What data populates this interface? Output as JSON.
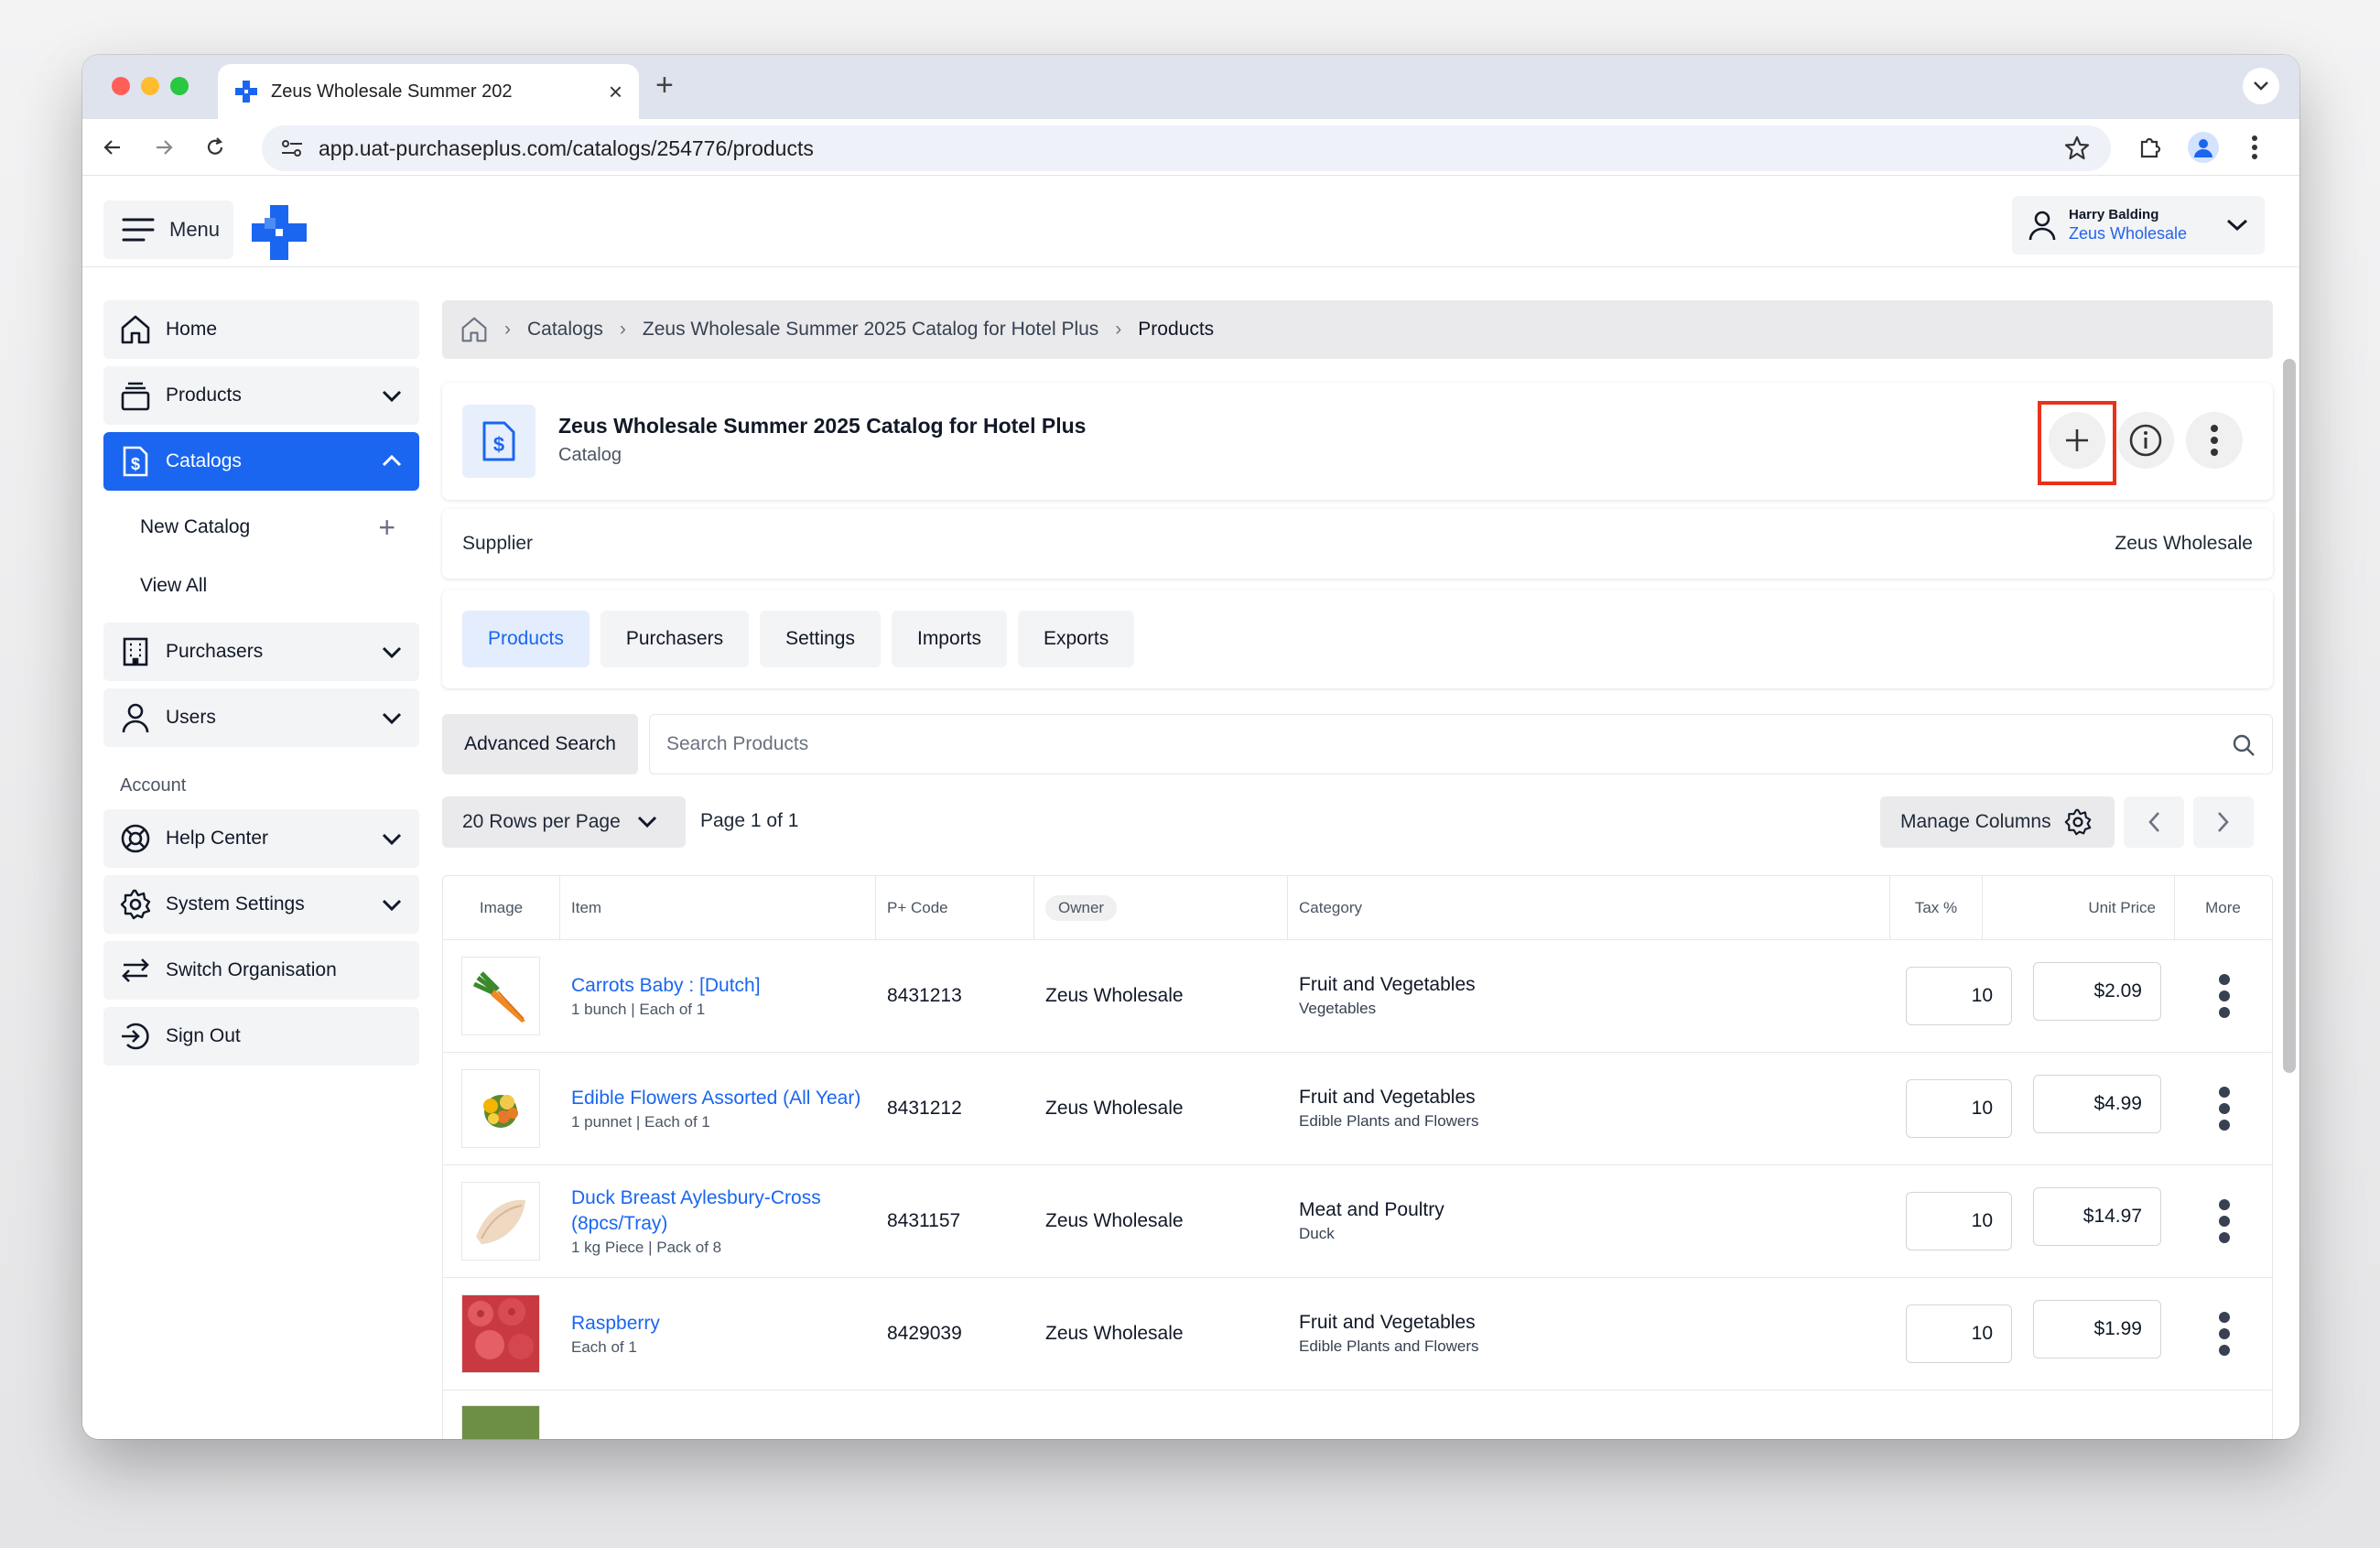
{
  "browser": {
    "tab_title": "Zeus Wholesale Summer 202",
    "url": "app.uat-purchaseplus.com/catalogs/254776/products",
    "new_tab": "+",
    "tab_close": "×"
  },
  "appbar": {
    "menu_label": "Menu",
    "user_name": "Harry Balding",
    "user_org": "Zeus Wholesale"
  },
  "sidebar": {
    "home": "Home",
    "products": "Products",
    "catalogs": "Catalogs",
    "new_catalog": "New Catalog",
    "view_all": "View All",
    "purchasers": "Purchasers",
    "users": "Users",
    "account_section": "Account",
    "help_center": "Help Center",
    "system_settings": "System Settings",
    "switch_org": "Switch Organisation",
    "sign_out": "Sign Out"
  },
  "breadcrumb": {
    "catalogs": "Catalogs",
    "catalog_name": "Zeus Wholesale Summer 2025 Catalog for Hotel Plus",
    "current": "Products"
  },
  "header": {
    "title": "Zeus Wholesale Summer 2025 Catalog for Hotel Plus",
    "subtitle": "Catalog"
  },
  "supplier": {
    "label": "Supplier",
    "value": "Zeus Wholesale"
  },
  "tabs": [
    "Products",
    "Purchasers",
    "Settings",
    "Imports",
    "Exports"
  ],
  "search": {
    "advanced_label": "Advanced Search",
    "placeholder": "Search Products"
  },
  "pager": {
    "rows_per_page": "20 Rows per Page",
    "page_info": "Page 1 of 1",
    "manage_columns": "Manage Columns"
  },
  "table": {
    "headers": {
      "image": "Image",
      "item": "Item",
      "code": "P+ Code",
      "owner": "Owner",
      "category": "Category",
      "tax": "Tax %",
      "unit_price": "Unit Price",
      "more": "More"
    },
    "rows": [
      {
        "name": "Carrots Baby : [Dutch]",
        "desc": "1 bunch | Each of 1",
        "code": "8431213",
        "owner": "Zeus Wholesale",
        "category": "Fruit and Vegetables",
        "subcategory": "Vegetables",
        "tax": "10",
        "price": "$2.09"
      },
      {
        "name": "Edible Flowers Assorted (All Year)",
        "desc": "1 punnet | Each of 1",
        "code": "8431212",
        "owner": "Zeus Wholesale",
        "category": "Fruit and Vegetables",
        "subcategory": "Edible Plants and Flowers",
        "tax": "10",
        "price": "$4.99"
      },
      {
        "name": "Duck Breast Aylesbury-Cross (8pcs/Tray)",
        "desc": "1 kg Piece | Pack of 8",
        "code": "8431157",
        "owner": "Zeus Wholesale",
        "category": "Meat and Poultry",
        "subcategory": "Duck",
        "tax": "10",
        "price": "$14.97"
      },
      {
        "name": "Raspberry",
        "desc": "Each of 1",
        "code": "8429039",
        "owner": "Zeus Wholesale",
        "category": "Fruit and Vegetables",
        "subcategory": "Edible Plants and Flowers",
        "tax": "10",
        "price": "$1.99"
      }
    ]
  },
  "colors": {
    "brand_blue": "#1a66f0",
    "highlight_red": "#e8321c"
  }
}
